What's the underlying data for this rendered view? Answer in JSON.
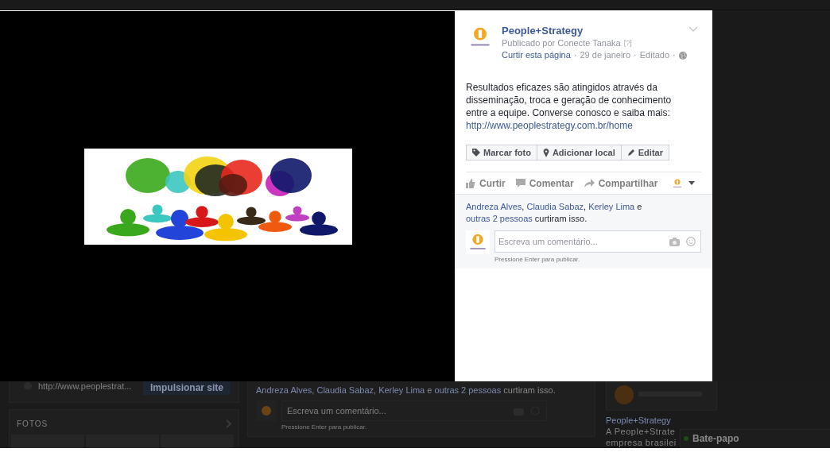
{
  "background_page": {
    "website_link": "http://www.peoplestrat...",
    "boost_button": "Impulsionar site",
    "photos_title": "FOTOS",
    "likes": [
      {
        "kind": "link",
        "text": "Andreza Alves"
      },
      {
        "kind": "text",
        "text": ", "
      },
      {
        "kind": "link",
        "text": "Claudia Sabaz"
      },
      {
        "kind": "text",
        "text": ", "
      },
      {
        "kind": "link",
        "text": "Kerley Lima"
      },
      {
        "kind": "text",
        "text": " e "
      },
      {
        "kind": "link",
        "text": "outras 2 pessoas"
      },
      {
        "kind": "text",
        "text": " curtiram isso."
      }
    ],
    "comment_placeholder": "Escreva um comentário...",
    "comment_hint": "Pressione Enter para publicar.",
    "sidebar": {
      "page_name": "People+Strategy",
      "about_line_1": "A People+Strate",
      "about_line_2": "empresa brasilei"
    },
    "chat": {
      "label": "Bate-papo",
      "online": true
    }
  },
  "post": {
    "page_name": "People+Strategy",
    "published_by": "Publicado por Conecte Tanaka",
    "help_mark": "[?]",
    "meta_separator": "·",
    "meta": [
      {
        "kind": "link",
        "text": "Curtir esta página"
      },
      {
        "kind": "text",
        "text": "29 de janeiro"
      },
      {
        "kind": "text",
        "text": "Editado"
      }
    ],
    "text": "Resultados eficazes são atingidos através da disseminação, troca e geração de conhecimento entre a equipe. Converse conosco e saiba mais:",
    "url": "http://www.peoplestrategy.com.br/home",
    "photo_buttons": [
      {
        "kind": "tag",
        "label": "Marcar foto"
      },
      {
        "kind": "place",
        "label": "Adicionar local"
      },
      {
        "kind": "edit",
        "label": "Editar"
      }
    ],
    "actions": [
      {
        "kind": "like",
        "label": "Curtir"
      },
      {
        "kind": "comment",
        "label": "Comentar"
      },
      {
        "kind": "share",
        "label": "Compartilhar"
      }
    ],
    "likes": [
      {
        "kind": "link",
        "text": "Andreza Alves"
      },
      {
        "kind": "text",
        "text": ", "
      },
      {
        "kind": "link",
        "text": "Claudia Sabaz"
      },
      {
        "kind": "text",
        "text": ", "
      },
      {
        "kind": "link",
        "text": "Kerley Lima"
      },
      {
        "kind": "text",
        "text": " e "
      },
      {
        "kind": "link",
        "text": "outras 2 pessoas"
      },
      {
        "kind": "text",
        "text": " curtiram isso."
      }
    ],
    "comment_placeholder": "Escreva um comentário...",
    "comment_hint": "Pressione Enter para publicar."
  }
}
